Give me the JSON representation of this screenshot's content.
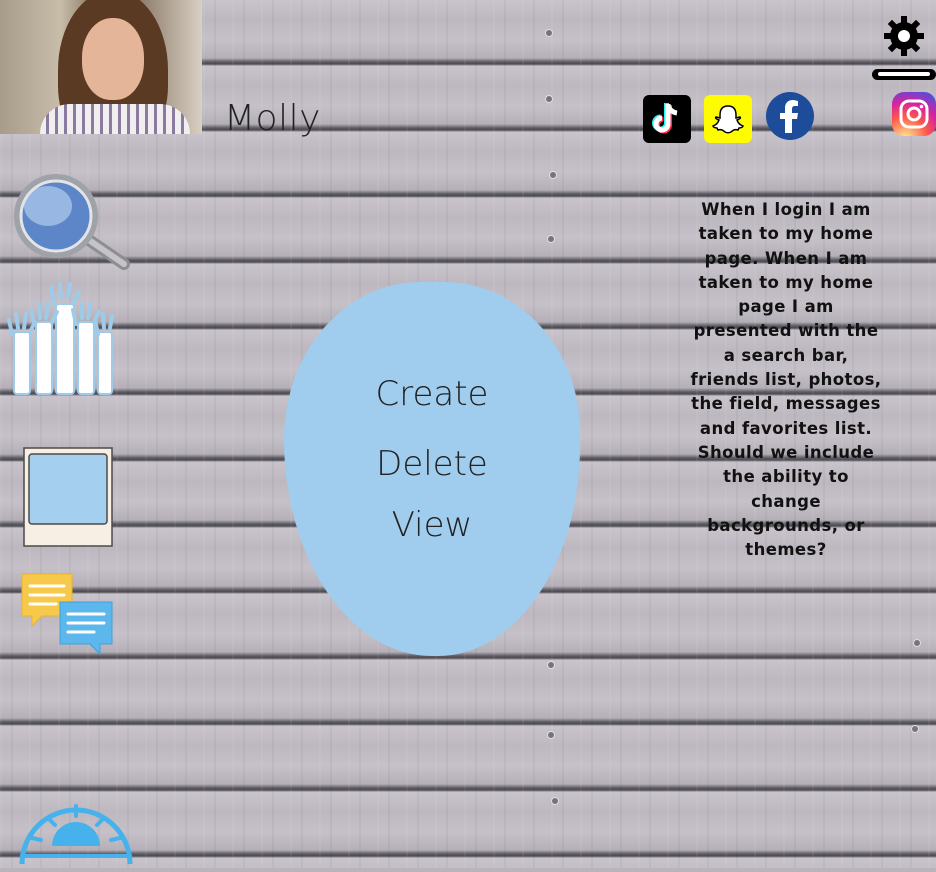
{
  "profile": {
    "name": "Molly",
    "avatar_alt": "profile-photo"
  },
  "social_links": [
    {
      "name": "tiktok",
      "icon": "tiktok-icon",
      "color": "#000000"
    },
    {
      "name": "snapchat",
      "icon": "snapchat-icon",
      "color": "#fffc00"
    },
    {
      "name": "facebook",
      "icon": "facebook-icon",
      "color": "#1d4c9b"
    },
    {
      "name": "instagram",
      "icon": "instagram-icon",
      "color": "#d6249f"
    }
  ],
  "settings": {
    "icon": "gear-icon"
  },
  "sidebar": {
    "items": [
      {
        "name": "search",
        "icon": "search-icon"
      },
      {
        "name": "friends",
        "icon": "friends-icon"
      },
      {
        "name": "photos",
        "icon": "photo-icon"
      },
      {
        "name": "messages",
        "icon": "messages-icon"
      },
      {
        "name": "field",
        "icon": "sunrise-icon"
      }
    ]
  },
  "menu": {
    "color": "#a0cdee",
    "items": [
      "Create",
      "Delete",
      "View"
    ]
  },
  "note": {
    "text": "When I login I am taken to my home page. When I am taken to my home page I am presented with the a search bar, friends list, photos, the field, messages and favorites list. Should we include the ability to change backgrounds, or themes?"
  }
}
